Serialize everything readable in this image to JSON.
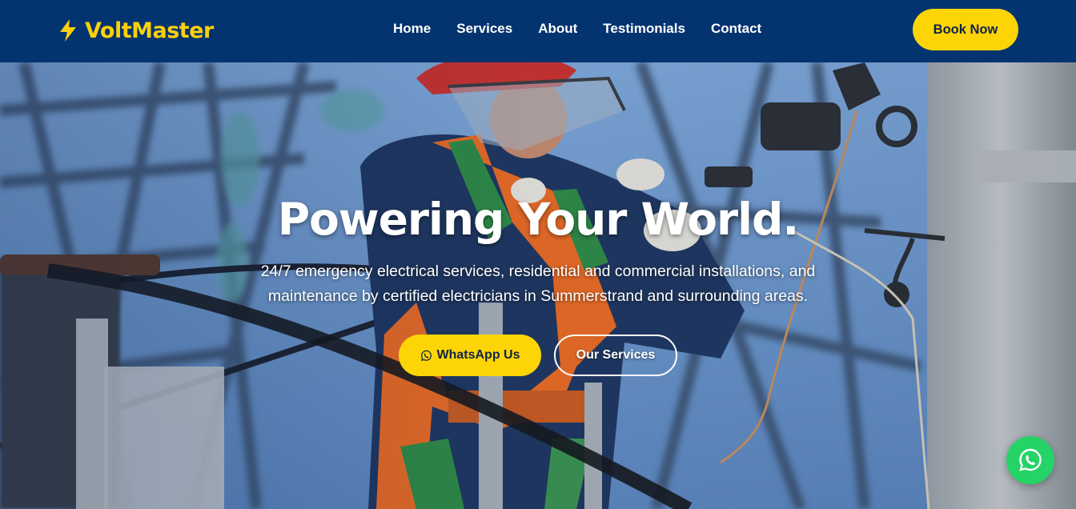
{
  "brand": {
    "name": "VoltMaster",
    "icon": "bolt-icon",
    "color": "#fbd00b"
  },
  "nav": {
    "links": [
      {
        "label": "Home"
      },
      {
        "label": "Services"
      },
      {
        "label": "About"
      },
      {
        "label": "Testimonials"
      },
      {
        "label": "Contact"
      }
    ],
    "cta_label": "Book Now",
    "background": "#04346f"
  },
  "hero": {
    "title": "Powering Your World.",
    "subtitle": "24/7 emergency electrical services, residential and commercial installations, and maintenance by certified electricians in Summerstrand and surrounding areas.",
    "primary_button": {
      "label": "WhatsApp Us",
      "icon": "whatsapp-icon"
    },
    "secondary_button": {
      "label": "Our Services"
    },
    "background_image": "electrician working on power line pylon"
  },
  "floating_button": {
    "icon": "whatsapp-icon",
    "color": "#25d366"
  },
  "colors": {
    "accent": "#fdd507",
    "dark": "#0f2346"
  }
}
